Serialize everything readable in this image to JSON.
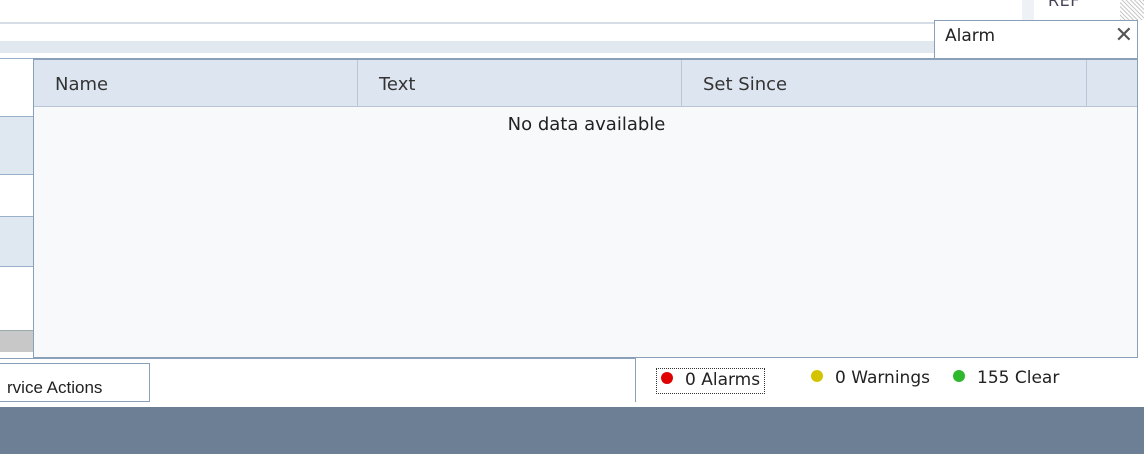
{
  "background": {
    "right_partial_label": "REF"
  },
  "alarm_popup": {
    "title": "Alarm",
    "close_glyph": "✕",
    "columns": [
      "Name",
      "Text",
      "Set Since",
      ""
    ],
    "empty_message": "No data available"
  },
  "footer": {
    "actions_button_label": "rvice Actions",
    "status": {
      "alarms": {
        "label": "0 Alarms",
        "color": "#e00000"
      },
      "warnings": {
        "label": "0 Warnings",
        "color": "#d4c400"
      },
      "clear": {
        "label": "155 Clear",
        "color": "#2eb82e"
      }
    }
  },
  "colors": {
    "header_bg": "#dde6f0",
    "border": "#8aa0b8",
    "bottom_band": "#6d7f95"
  }
}
